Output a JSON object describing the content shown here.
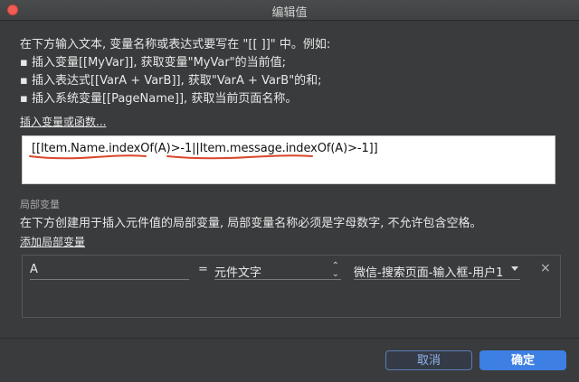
{
  "window": {
    "title": "编辑值"
  },
  "intro": {
    "line1": "在下方输入文本, 变量名称或表达式要写在 \"[[ ]]\" 中。例如:",
    "line2": "▪ 插入变量[[MyVar]], 获取变量\"MyVar\"的当前值;",
    "line3": "▪ 插入表达式[[VarA + VarB]], 获取\"VarA + VarB\"的和;",
    "line4": "▪ 插入系统变量[[PageName]], 获取当前页面名称。"
  },
  "insert_link": "插入变量或函数...",
  "editor": {
    "expression": "[[Item.Name.indexOf(A)>-1||Item.message.indexOf(A)>-1]]",
    "annotation_color": "#d9472b"
  },
  "local_vars": {
    "section_label": "局部变量",
    "description": "在下方创建用于插入元件值的局部变量, 局部变量名称必须是字母数字, 不允许包含空格。",
    "add_link": "添加局部变量",
    "rows": [
      {
        "name": "A",
        "equals": "=",
        "type": "元件文字",
        "target": "微信-搜索页面-输入框-用户1",
        "remove": "×"
      }
    ]
  },
  "buttons": {
    "cancel": "取消",
    "ok": "确定"
  },
  "colors": {
    "accent": "#3d7fe3",
    "background": "#3a3b3d"
  }
}
